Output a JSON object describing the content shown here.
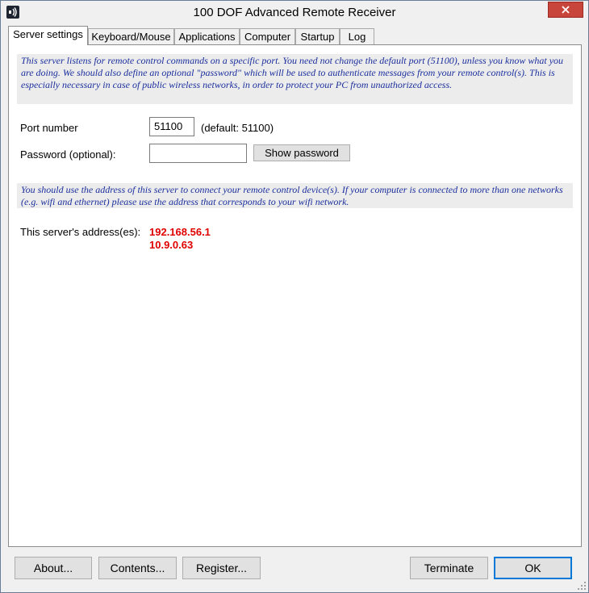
{
  "window": {
    "title": "100 DOF Advanced Remote Receiver"
  },
  "tabs": [
    {
      "label": "Server settings",
      "active": true
    },
    {
      "label": "Keyboard/Mouse",
      "active": false
    },
    {
      "label": "Applications",
      "active": false
    },
    {
      "label": "Computer",
      "active": false
    },
    {
      "label": "Startup",
      "active": false
    },
    {
      "label": "Log",
      "active": false
    }
  ],
  "server_settings": {
    "info_port": "This server listens for remote control commands on a specific port. You need not change the default port (51100), unless you know what you are doing. We should also define an optional \"password\" which will be used to authenticate messages from your remote control(s). This is especially necessary in case of public wireless networks, in order to protect your PC from unauthorized access.",
    "port_label": "Port number",
    "port_value": "51100",
    "port_default": "(default: 51100)",
    "password_label": "Password (optional):",
    "password_value": "",
    "show_password_label": "Show password",
    "info_address": "You should use the address of this server to connect your remote control device(s). If your computer is connected to more than one networks (e.g. wifi and ethernet) please use the address that corresponds to your wifi network.",
    "address_label": "This server's address(es):",
    "addresses": [
      "192.168.56.1",
      "10.9.0.63"
    ]
  },
  "buttons": {
    "about": "About...",
    "contents": "Contents...",
    "register": "Register...",
    "terminate": "Terminate",
    "ok": "OK"
  },
  "colors": {
    "info_text": "#1b2f9e",
    "address_text": "#e00000",
    "close_button": "#c7453b"
  },
  "icons": {
    "app": "remote-signal-icon",
    "close": "close-icon",
    "resize": "resize-grip-icon"
  }
}
